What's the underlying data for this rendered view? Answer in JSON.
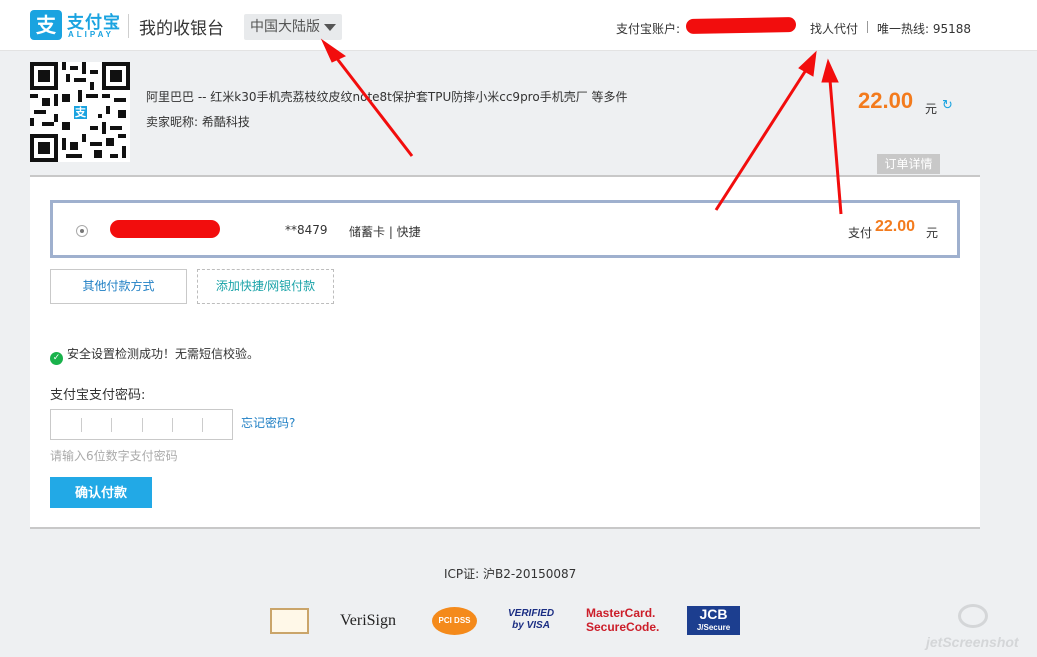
{
  "header": {
    "logo_text": "支付宝",
    "logo_sub": "ALIPAY",
    "logo_glyph": "支",
    "page_title": "我的收银台",
    "region_label": "中国大陆版",
    "account_label": "支付宝账户:",
    "proxy_pay_label": "找人代付",
    "hotline_label": "唯一热线: 95188"
  },
  "order": {
    "title": "阿里巴巴 -- 红米k30手机壳荔枝纹皮纹note8t保护套TPU防摔小米cc9pro手机壳厂 等多件",
    "seller": "卖家昵称: 希酷科技",
    "amount": "22.00",
    "amount_unit": "元",
    "refresh_icon": "↻",
    "detail_tab_label": "订单详情",
    "qr_logo_glyph": "支"
  },
  "payment": {
    "card_no": "**8479",
    "card_type": "储蓄卡 | 快捷",
    "pay_label": "支付",
    "pay_amount": "22.00",
    "pay_unit": "元",
    "other_method_label": "其他付款方式",
    "add_method_label": "添加快捷/网银付款",
    "security_text": "安全设置检测成功！无需短信校验。",
    "password_label": "支付宝支付密码:",
    "forgot_label": "忘记密码?",
    "password_hint": "请输入6位数字支付密码",
    "confirm_label": "确认付款"
  },
  "footer": {
    "icp": "ICP证: 沪B2-20150087",
    "badges": {
      "verisign": "VeriSign",
      "pci": "PCI DSS",
      "visa_line1": "VERIFIED",
      "visa_line2": "by VISA",
      "mc_line1": "MasterCard.",
      "mc_line2": "SecureCode.",
      "jcb_line1": "JCB",
      "jcb_line2": "J/Secure"
    },
    "watermark": "jetScreenshot"
  },
  "colors": {
    "brand_blue": "#1aa3e0",
    "amount_orange": "#f37b1d",
    "confirm_button": "#22a9e6",
    "arrow_red": "#f20d0d"
  }
}
